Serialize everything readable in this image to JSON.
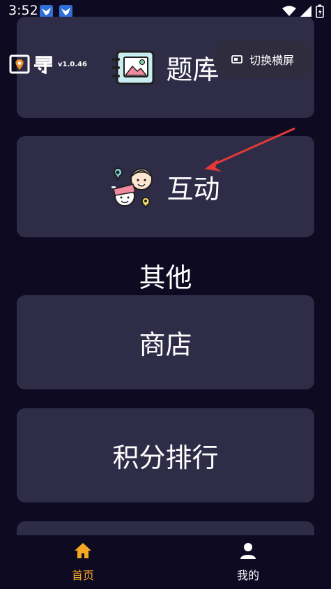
{
  "status_bar": {
    "time": "3:52"
  },
  "header": {
    "version": "v1.0.46"
  },
  "toast": {
    "label": "切换横屏"
  },
  "cards": {
    "question_bank": "题库",
    "interaction": "互动",
    "shop": "商店",
    "points_ranking": "积分排行"
  },
  "section_other": "其他",
  "tabbar": {
    "home": "首页",
    "mine": "我的",
    "active_color": "#f5a623",
    "inactive_color": "#ffffff"
  },
  "colors": {
    "background": "#0d0a22",
    "card": "#2e2c47",
    "annotation_arrow": "#e53935"
  }
}
